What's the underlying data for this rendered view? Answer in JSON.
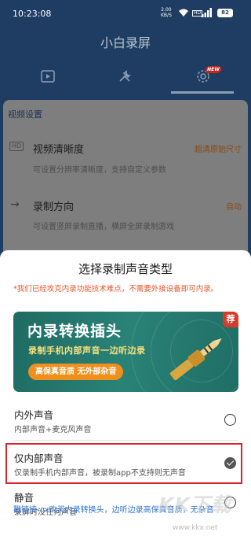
{
  "status_bar": {
    "time": "10:23:08",
    "net_speed": "2.00",
    "net_unit": "KB/S",
    "hd_label": "HD",
    "battery": "82"
  },
  "app": {
    "title": "小白录屏",
    "tabs": [
      {
        "icon": "video-icon"
      },
      {
        "icon": "tools-icon"
      },
      {
        "icon": "gear-icon",
        "badge": "NEW"
      }
    ]
  },
  "settings": {
    "section_title": "视频设置",
    "rows": [
      {
        "icon_text": "HD",
        "label": "视频清晰度",
        "value": "超清原始尺寸",
        "sub": "可设置分辨率清晰度，支持自定义参数"
      },
      {
        "icon_text": "→",
        "label": "录制方向",
        "value": "自动",
        "sub": "可设置竖屏录制直播，横屏全屏录制游戏"
      }
    ]
  },
  "sheet": {
    "title": "选择录制声音类型",
    "tip": "*我们已经攻克内录功能技术难点，不需要外接设备即可内录。",
    "banner": {
      "headline": "内录转换插头",
      "subline": "录制手机内部声音一边听边录",
      "pill": "高保真音质 无外部杂音",
      "badge": "荐"
    },
    "options": [
      {
        "label": "内外声音",
        "sub": "内部声音+麦克风声音",
        "checked": false
      },
      {
        "label": "仅内部声音",
        "sub": "仅录制手机内部声音，被录制app不支持则无声音",
        "checked": true
      },
      {
        "label": "静音",
        "sub": "录屏时没任何声音",
        "checked": false
      }
    ],
    "footer_link": "戳链接-->购买内录转换头，边听边录高保真音质，无杂音"
  },
  "watermark": {
    "text": "KK下载",
    "url": "www.kkx.net"
  },
  "colors": {
    "header_bg": "#1f3d63",
    "tip_orange": "#e5552b",
    "banner_green": "#2a8277",
    "banner_pill": "#f18f1d",
    "link_blue": "#2b73d6",
    "highlight_red": "#d8232a"
  }
}
